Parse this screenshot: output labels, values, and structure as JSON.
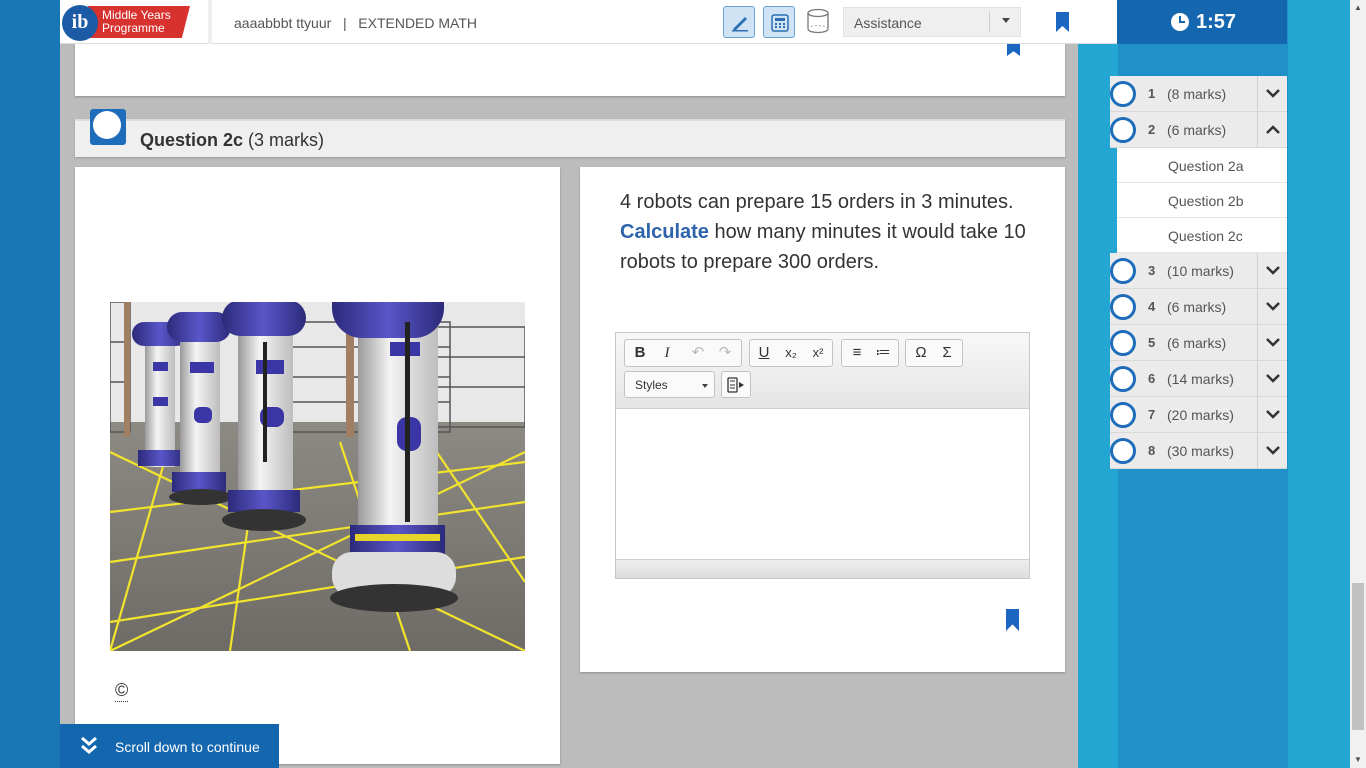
{
  "header": {
    "logo_line1": "Middle Years",
    "logo_line2": "Programme",
    "logo_mark": "ib",
    "student_and_subject": "aaaabbbt ttyuur   |   EXTENDED MATH",
    "tools": {
      "pen_icon": "pen-icon",
      "calculator_icon": "calculator-icon",
      "shape_icon": "cylinder-icon"
    },
    "assistance_label": "Assistance"
  },
  "timer": {
    "value": "1:57"
  },
  "question": {
    "title": "Question 2c",
    "marks": "(3 marks)",
    "text_before": "4 robots can prepare 15 orders in 3 minutes. ",
    "command_term": "Calculate",
    "text_after": " how many minutes it would take 10 robots to prepare 300 orders.",
    "copyright": "©"
  },
  "editor": {
    "buttons": [
      "B",
      "I",
      "↶",
      "↷",
      "U",
      "x₂",
      "x²",
      "≡",
      "≔",
      "Ω",
      "Σ"
    ],
    "styles_label": "Styles"
  },
  "scroll": {
    "label": "Scroll down to continue"
  },
  "nav": {
    "items": [
      {
        "num": "1",
        "marks": "(8 marks)",
        "open": false
      },
      {
        "num": "2",
        "marks": "(6 marks)",
        "open": true
      },
      {
        "num": "3",
        "marks": "(10 marks)",
        "open": false
      },
      {
        "num": "4",
        "marks": "(6 marks)",
        "open": false
      },
      {
        "num": "5",
        "marks": "(6 marks)",
        "open": false
      },
      {
        "num": "6",
        "marks": "(14 marks)",
        "open": false
      },
      {
        "num": "7",
        "marks": "(20 marks)",
        "open": false
      },
      {
        "num": "8",
        "marks": "(30 marks)",
        "open": false
      }
    ],
    "sub_items": [
      "Question 2a",
      "Question 2b",
      "Question 2c"
    ]
  },
  "colors": {
    "accent": "#1467ae",
    "command_term": "#2e64ab",
    "side_bg": "#24a6d3"
  }
}
